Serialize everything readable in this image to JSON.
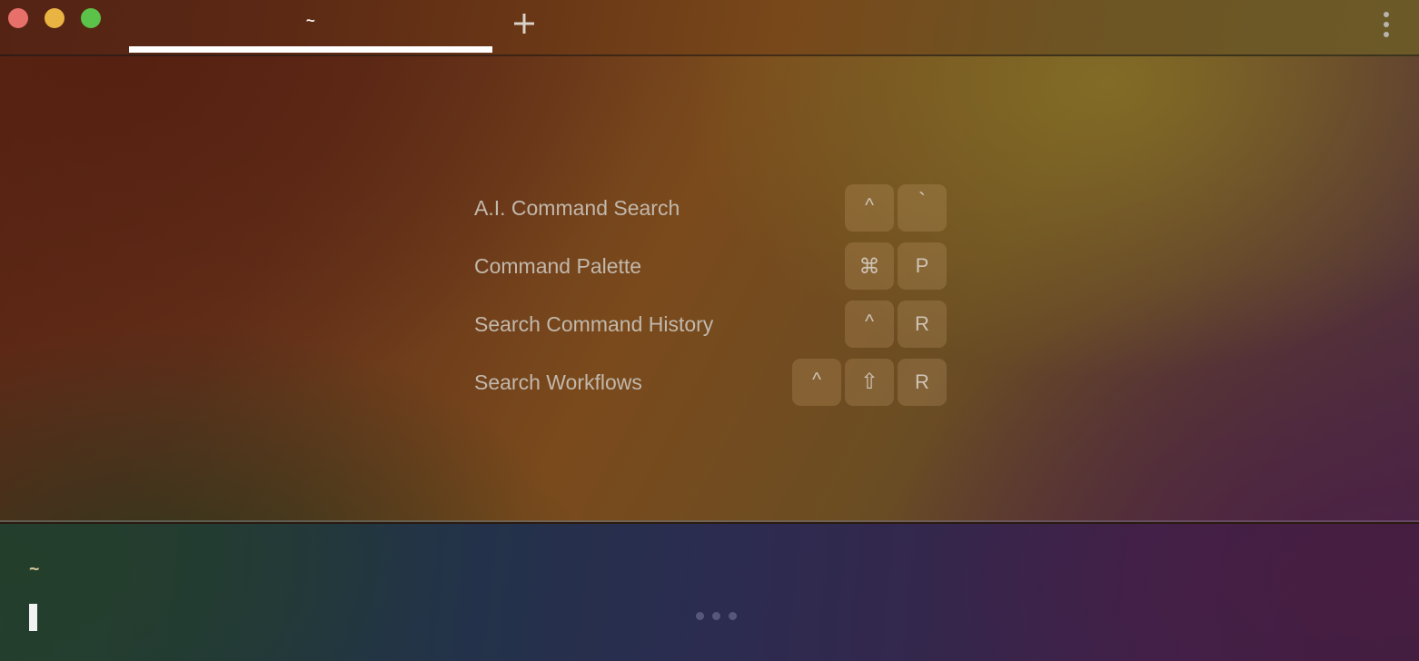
{
  "window": {
    "controls": [
      {
        "name": "close",
        "color": "#e8706a"
      },
      {
        "name": "minimize",
        "color": "#e9b442"
      },
      {
        "name": "maximize",
        "color": "#5bc24a"
      }
    ]
  },
  "tabbar": {
    "tabs": [
      {
        "label": "~",
        "active": true
      }
    ],
    "new_tab_label": "+",
    "overflow_label": "",
    "active_indicator_color": "#ffffff"
  },
  "hints": {
    "rows": [
      {
        "label": "A.I. Command Search",
        "keys": [
          {
            "glyph": "^",
            "name": "control-key",
            "style": "glyph-ctrl"
          },
          {
            "glyph": "`",
            "name": "backtick-key",
            "style": "glyph-tick"
          }
        ]
      },
      {
        "label": "Command Palette",
        "keys": [
          {
            "glyph": "⌘",
            "name": "command-key",
            "style": "glyph-cmd"
          },
          {
            "glyph": "P",
            "name": "p-key",
            "style": ""
          }
        ]
      },
      {
        "label": "Search Command History",
        "keys": [
          {
            "glyph": "^",
            "name": "control-key",
            "style": "glyph-ctrl"
          },
          {
            "glyph": "R",
            "name": "r-key",
            "style": ""
          }
        ]
      },
      {
        "label": "Search Workflows",
        "keys": [
          {
            "glyph": "^",
            "name": "control-key",
            "style": "glyph-ctrl"
          },
          {
            "glyph": "⇧",
            "name": "shift-key",
            "style": "glyph-shift"
          },
          {
            "glyph": "R",
            "name": "r-key",
            "style": ""
          }
        ]
      }
    ]
  },
  "terminal": {
    "prompt_symbol": "~",
    "input_value": "",
    "cursor_visible": true,
    "loading_dots": 3
  },
  "colors": {
    "label_text": "#c2b8ac",
    "keycap_text": "#cfc4b6",
    "prompt_text": "#d7c79a",
    "cursor": "#f2f2f2",
    "accent": "#ffffff"
  }
}
